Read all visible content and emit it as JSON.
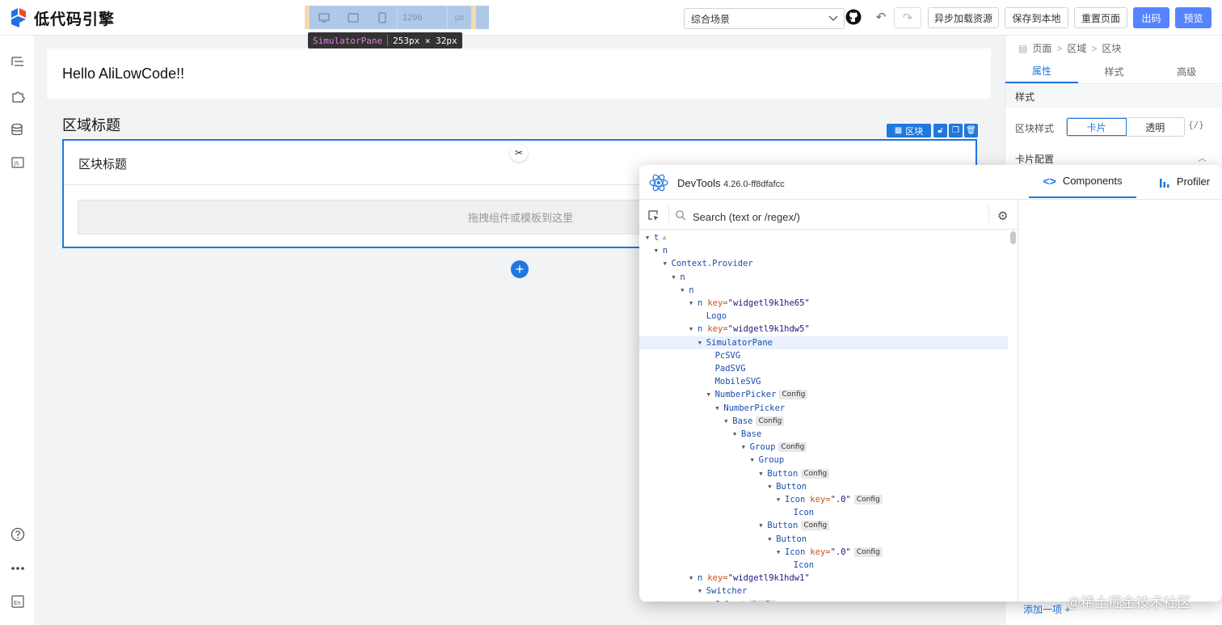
{
  "app": {
    "title": "低代码引擎"
  },
  "device_bar": {
    "width_value": "1296",
    "unit": "px"
  },
  "tooltip": {
    "name": "SimulatorPane",
    "size": "253px × 32px"
  },
  "toolbar": {
    "scene_select": "综合场景",
    "async_load": "异步加载资源",
    "save_local": "保存到本地",
    "reset_page": "重置页面",
    "export_code": "出码",
    "preview": "预览"
  },
  "canvas": {
    "hello_text": "Hello AliLowCode!!",
    "region_title": "区域标题",
    "block_title": "区块标题",
    "drop_hint": "拖拽组件或模板到这里",
    "block_tag": "区块"
  },
  "right_panel": {
    "breadcrumb": [
      "页面",
      "区域",
      "区块"
    ],
    "tabs": [
      "属性",
      "样式",
      "高级"
    ],
    "active_tab": "属性",
    "section_style": "样式",
    "block_style_label": "区块样式",
    "block_style_options": [
      "卡片",
      "透明"
    ],
    "block_style_selected": "卡片",
    "variable_btn": "{/}",
    "card_config": "卡片配置",
    "add_item": "添加一项 +"
  },
  "devtools": {
    "title": "DevTools",
    "version": "4.26.0-ff8dfafcc",
    "tabs": [
      "Components",
      "Profiler"
    ],
    "active_tab": "Components",
    "search_placeholder": "Search (text or /regex/)",
    "tree": [
      {
        "depth": 0,
        "arrow": true,
        "name": "t",
        "warn": true
      },
      {
        "depth": 1,
        "arrow": true,
        "name": "n"
      },
      {
        "depth": 2,
        "arrow": true,
        "name": "Context.Provider"
      },
      {
        "depth": 3,
        "arrow": true,
        "name": "n"
      },
      {
        "depth": 4,
        "arrow": true,
        "name": "n"
      },
      {
        "depth": 5,
        "arrow": true,
        "name": "n",
        "key": "widgetl9k1he65"
      },
      {
        "depth": 6,
        "arrow": false,
        "name": "Logo"
      },
      {
        "depth": 5,
        "arrow": true,
        "name": "n",
        "key": "widgetl9k1hdw5"
      },
      {
        "depth": 6,
        "arrow": true,
        "name": "SimulatorPane",
        "selected": true
      },
      {
        "depth": 7,
        "arrow": false,
        "name": "PcSVG"
      },
      {
        "depth": 7,
        "arrow": false,
        "name": "PadSVG"
      },
      {
        "depth": 7,
        "arrow": false,
        "name": "MobileSVG"
      },
      {
        "depth": 7,
        "arrow": true,
        "name": "NumberPicker",
        "badge": "Config"
      },
      {
        "depth": 8,
        "arrow": true,
        "name": "NumberPicker"
      },
      {
        "depth": 9,
        "arrow": true,
        "name": "Base",
        "badge": "Config"
      },
      {
        "depth": 10,
        "arrow": true,
        "name": "Base"
      },
      {
        "depth": 11,
        "arrow": true,
        "name": "Group",
        "badge": "Config"
      },
      {
        "depth": 12,
        "arrow": true,
        "name": "Group"
      },
      {
        "depth": 13,
        "arrow": true,
        "name": "Button",
        "badge": "Config"
      },
      {
        "depth": 14,
        "arrow": true,
        "name": "Button"
      },
      {
        "depth": 15,
        "arrow": true,
        "name": "Icon",
        "key": ".0",
        "badge": "Config"
      },
      {
        "depth": 16,
        "arrow": false,
        "name": "Icon"
      },
      {
        "depth": 13,
        "arrow": true,
        "name": "Button",
        "badge": "Config"
      },
      {
        "depth": 14,
        "arrow": true,
        "name": "Button"
      },
      {
        "depth": 15,
        "arrow": true,
        "name": "Icon",
        "key": ".0",
        "badge": "Config"
      },
      {
        "depth": 16,
        "arrow": false,
        "name": "Icon"
      },
      {
        "depth": 5,
        "arrow": true,
        "name": "n",
        "key": "widgetl9k1hdw1"
      },
      {
        "depth": 6,
        "arrow": true,
        "name": "Switcher"
      },
      {
        "depth": 7,
        "arrow": false,
        "name": "Select",
        "badge": "Config"
      }
    ]
  },
  "watermark": "@稀土掘金技术社区",
  "colors": {
    "primary": "#1f78e0",
    "button_primary": "#5584ff"
  }
}
